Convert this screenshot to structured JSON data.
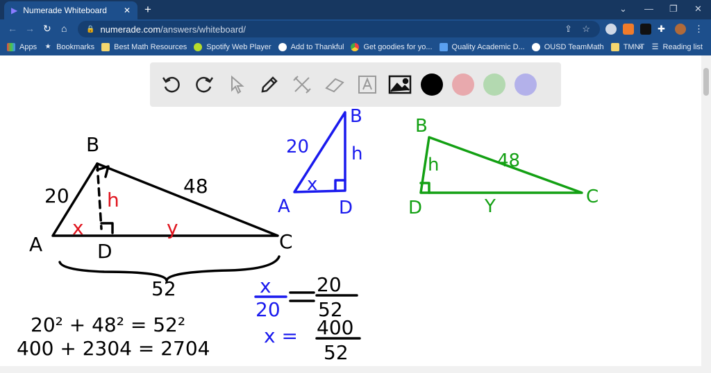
{
  "browser": {
    "tab_title": "Numerade Whiteboard",
    "url_host": "numerade.com",
    "url_path": "/answers/whiteboard/"
  },
  "bookmarks": [
    "Apps",
    "Bookmarks",
    "Best Math Resources",
    "Spotify Web Player",
    "Add to Thankful",
    "Get goodies for yo...",
    "Quality Academic D...",
    "OUSD TeamMath",
    "TMNT"
  ],
  "reading_list": "Reading list",
  "more": "»",
  "toolbar": {
    "tools": [
      "undo-icon",
      "redo-icon",
      "pointer-icon",
      "pen-icon",
      "tools-icon",
      "eraser-icon",
      "text-icon",
      "image-icon"
    ],
    "colors": [
      "#000000",
      "#e8a9ad",
      "#b3d9b0",
      "#b3b1ea"
    ]
  },
  "drawing": {
    "t1": {
      "B": "B",
      "A": "A",
      "C": "C",
      "D": "D",
      "ab": "20",
      "bc": "48",
      "h": "h",
      "x": "x",
      "y": "y",
      "base": "52"
    },
    "t2": {
      "B": "B",
      "A": "A",
      "D": "D",
      "ab": "20",
      "h": "h",
      "x": "x"
    },
    "t3": {
      "B": "B",
      "D": "D",
      "C": "C",
      "bc": "48",
      "h": "h",
      "y": "Y"
    },
    "eq1": "20² + 48² = 52²",
    "eq2": "400 + 2304 = 2704",
    "frac1_num": "x",
    "frac1_den": "20",
    "frac2_num": "20",
    "frac2_den": "52",
    "eq_x": "x =",
    "frac3_num": "400",
    "frac3_den": "52"
  }
}
